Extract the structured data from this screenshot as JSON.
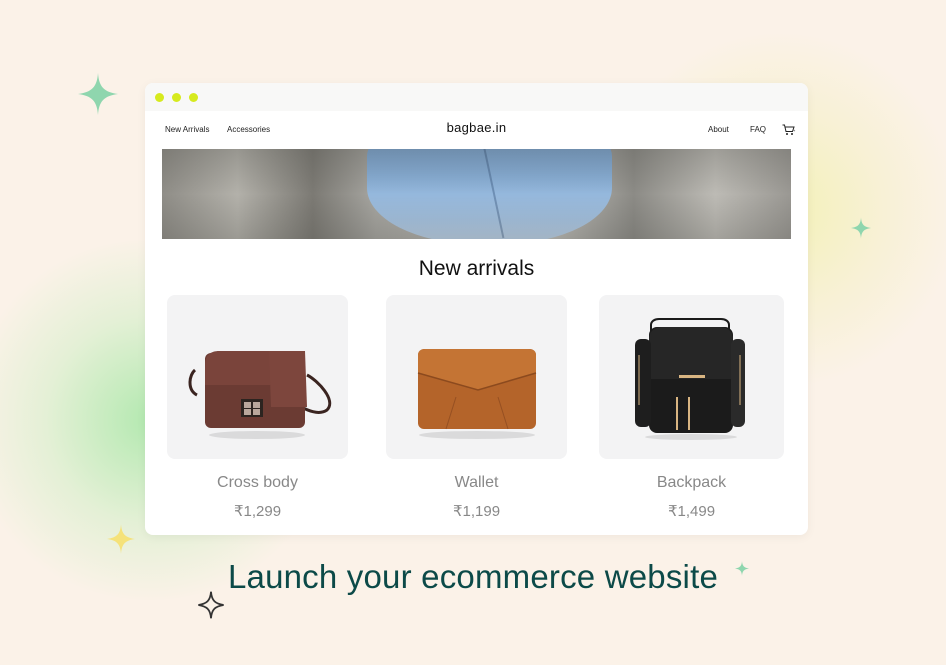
{
  "colors": {
    "background": "#fbf2e8",
    "window_dots": "#d6ea1e",
    "tagline": "#0c4a48",
    "muted_text": "#888888"
  },
  "site": {
    "nav_left": [
      "New Arrivals",
      "Accessories"
    ],
    "brand": "bagbae.in",
    "nav_right": [
      "About",
      "FAQ"
    ],
    "cart_icon": "cart-icon"
  },
  "section": {
    "title": "New arrivals"
  },
  "products": [
    {
      "name": "Cross body",
      "price": "₹1,299",
      "image": "crossbody-bag-image"
    },
    {
      "name": "Wallet",
      "price": "₹1,199",
      "image": "wallet-image"
    },
    {
      "name": "Backpack",
      "price": "₹1,499",
      "image": "backpack-image"
    }
  ],
  "tagline": "Launch your ecommerce website"
}
